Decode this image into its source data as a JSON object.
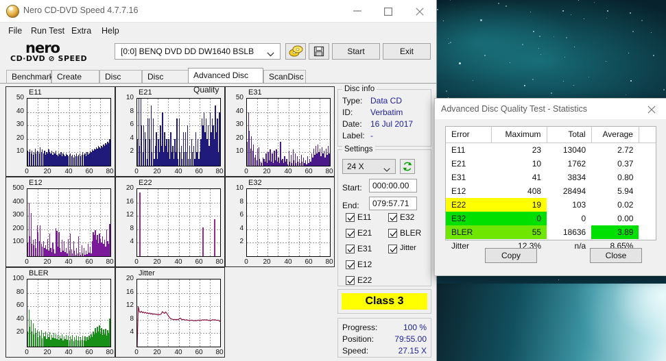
{
  "window": {
    "title": "Nero CD-DVD Speed 4.7.7.16",
    "icon": "nero-disc-icon",
    "minimize": "minimize-icon",
    "maximize": "maximize-icon",
    "close": "close-icon"
  },
  "menu": [
    "File",
    "Run Test",
    "Extra",
    "Help"
  ],
  "toolbar": {
    "logo_main": "nero",
    "logo_sub": "CD·DVD ⊘ SPEED",
    "drive": "[0:0]   BENQ DVD DD DW1640 BSLB",
    "refresh_icon": "refresh-disc-icon",
    "save_icon": "save-floppy-icon",
    "start": "Start",
    "exit": "Exit"
  },
  "tabs": [
    {
      "label": "Benchmark",
      "active": false
    },
    {
      "label": "Create Disc",
      "active": false
    },
    {
      "label": "Disc Info",
      "active": false
    },
    {
      "label": "Disc Quality",
      "active": false
    },
    {
      "label": "Advanced Disc Quality",
      "active": true
    },
    {
      "label": "ScanDisc",
      "active": false
    }
  ],
  "disc_info": {
    "legend": "Disc info",
    "rows": [
      {
        "label": "Type:",
        "value": "Data CD"
      },
      {
        "label": "ID:",
        "value": "Verbatim"
      },
      {
        "label": "Date:",
        "value": "16 Jul 2017"
      },
      {
        "label": "Label:",
        "value": "-"
      }
    ]
  },
  "settings": {
    "legend": "Settings",
    "speed": "24 X",
    "speed_refresh_icon": "refresh-arrows-icon",
    "start_label": "Start:",
    "start_value": "000:00.00",
    "end_label": "End:",
    "end_value": "079:57.71",
    "checkboxes": [
      {
        "label": "E11",
        "checked": true
      },
      {
        "label": "E21",
        "checked": true
      },
      {
        "label": "E31",
        "checked": true
      },
      {
        "label": "E12",
        "checked": true
      },
      {
        "label": "E22",
        "checked": true
      },
      {
        "label": "E32",
        "checked": true
      },
      {
        "label": "BLER",
        "checked": true
      },
      {
        "label": "Jitter",
        "checked": true
      }
    ]
  },
  "class_box": "Class 3",
  "progress": {
    "rows": [
      {
        "label": "Progress:",
        "value": "100 %"
      },
      {
        "label": "Position:",
        "value": "79:55.00"
      },
      {
        "label": "Speed:",
        "value": "27.15 X"
      }
    ]
  },
  "dialog": {
    "title": "Advanced Disc Quality Test - Statistics",
    "close_icon": "close-icon",
    "columns": [
      "Error",
      "Maximum",
      "Total",
      "Average"
    ],
    "rows": [
      {
        "error": "E11",
        "maximum": "23",
        "total": "13040",
        "average": "2.72",
        "hl": "none"
      },
      {
        "error": "E21",
        "maximum": "10",
        "total": "1762",
        "average": "0.37",
        "hl": "none"
      },
      {
        "error": "E31",
        "maximum": "41",
        "total": "3834",
        "average": "0.80",
        "hl": "none"
      },
      {
        "error": "E12",
        "maximum": "408",
        "total": "28494",
        "average": "5.94",
        "hl": "none"
      },
      {
        "error": "E22",
        "maximum": "19",
        "total": "103",
        "average": "0.02",
        "hl": "yellow"
      },
      {
        "error": "E32",
        "maximum": "0",
        "total": "0",
        "average": "0.00",
        "hl": "green"
      },
      {
        "error": "BLER",
        "maximum": "55",
        "total": "18636",
        "average": "3.89",
        "hl": "lightgreen",
        "avg_hl": "green"
      },
      {
        "error": "Jitter",
        "maximum": "12.3%",
        "total": "n/a",
        "average": "8.65%",
        "hl": "none"
      }
    ],
    "copy": "Copy",
    "close": "Close",
    "colors": {
      "yellow": "#ffff00",
      "green": "#00e000",
      "lightgreen": "#6ee600"
    }
  },
  "chart_data": [
    {
      "type": "bar",
      "title": "E11",
      "color": "#201a7a",
      "xlabel": "",
      "ylabel": "",
      "xlim": [
        0,
        80
      ],
      "ylim": [
        0,
        50
      ],
      "grid": true,
      "xticks": [
        0,
        20,
        40,
        60,
        80
      ],
      "yticks": [
        10,
        20,
        30,
        40,
        50
      ],
      "values": [
        11,
        10,
        12,
        9,
        11,
        8,
        10,
        13,
        9,
        11,
        10,
        9,
        14,
        10,
        12,
        9,
        11,
        8,
        10,
        9,
        12,
        10,
        9,
        11,
        8,
        10,
        9,
        11,
        8,
        7,
        9,
        8,
        10,
        7,
        9,
        8,
        7,
        9,
        8,
        7,
        8,
        9,
        7,
        8,
        6,
        8,
        7,
        9,
        7,
        8,
        9,
        7,
        8,
        10,
        8,
        9,
        7,
        10,
        8,
        9,
        11,
        10,
        12,
        11,
        13,
        12,
        14,
        13,
        15,
        14,
        13,
        15,
        14,
        16,
        15,
        17,
        16,
        18,
        17,
        20
      ]
    },
    {
      "type": "bar",
      "title": "E21",
      "color": "#201a7a",
      "xlabel": "",
      "ylabel": "",
      "xlim": [
        0,
        80
      ],
      "ylim": [
        0,
        10
      ],
      "grid": true,
      "xticks": [
        0,
        20,
        40,
        60,
        80
      ],
      "yticks": [
        2,
        4,
        6,
        8,
        10
      ],
      "values": [
        4,
        10,
        3,
        10,
        6,
        2,
        6,
        5,
        4,
        1,
        7,
        7,
        4,
        9,
        2,
        7,
        1,
        3,
        5,
        1,
        4,
        2,
        6,
        3,
        8,
        2,
        5,
        3,
        4,
        2,
        4,
        1,
        5,
        2,
        3,
        1,
        4,
        2,
        7,
        1,
        7,
        2,
        3,
        1,
        5,
        2,
        5,
        2,
        6,
        1,
        3,
        1,
        4,
        2,
        3,
        1,
        5,
        2,
        4,
        1,
        2,
        4,
        7,
        6,
        8,
        5,
        7,
        4,
        6,
        3,
        8,
        5,
        7,
        6,
        4,
        9,
        5,
        7,
        2,
        8
      ]
    },
    {
      "type": "bar",
      "title": "E31",
      "color": "#4a1a8a",
      "xlabel": "",
      "ylabel": "",
      "xlim": [
        0,
        80
      ],
      "ylim": [
        0,
        50
      ],
      "grid": true,
      "xticks": [
        0,
        20,
        40,
        60,
        80
      ],
      "yticks": [
        10,
        20,
        30,
        40,
        50
      ],
      "values": [
        18,
        40,
        26,
        13,
        22,
        11,
        16,
        6,
        8,
        4,
        13,
        14,
        5,
        3,
        2,
        6,
        5,
        3,
        9,
        2,
        10,
        4,
        12,
        3,
        9,
        2,
        11,
        4,
        12,
        3,
        6,
        2,
        18,
        4,
        5,
        2,
        7,
        3,
        5,
        1,
        11,
        3,
        8,
        2,
        12,
        4,
        9,
        2,
        7,
        3,
        5,
        2,
        8,
        3,
        6,
        2,
        4,
        1,
        7,
        2,
        5,
        3,
        9,
        6,
        13,
        8,
        15,
        9,
        16,
        10,
        12,
        7,
        14,
        9,
        11,
        6,
        13,
        8,
        15,
        9
      ]
    },
    {
      "type": "bar",
      "title": "E12",
      "color": "#7a1a9a",
      "xlabel": "",
      "ylabel": "",
      "xlim": [
        0,
        80
      ],
      "ylim": [
        0,
        500
      ],
      "grid": true,
      "xticks": [
        0,
        20,
        40,
        60,
        80
      ],
      "yticks": [
        100,
        200,
        300,
        400,
        500
      ],
      "values": [
        100,
        400,
        150,
        320,
        90,
        120,
        80,
        130,
        60,
        230,
        180,
        110,
        230,
        90,
        70,
        110,
        60,
        80,
        50,
        130,
        40,
        170,
        60,
        30,
        100,
        50,
        20,
        210,
        190,
        70,
        180,
        60,
        30,
        120,
        40,
        110,
        30,
        60,
        20,
        130,
        40,
        170,
        50,
        20,
        110,
        40,
        10,
        60,
        20,
        150,
        30,
        10,
        80,
        20,
        60,
        10,
        40,
        15,
        90,
        25,
        70,
        20,
        110,
        180,
        160,
        195,
        120,
        160,
        95,
        170,
        130,
        100,
        150,
        90,
        120,
        70,
        200,
        110,
        90,
        240
      ]
    },
    {
      "type": "bar",
      "title": "E22",
      "color": "#9a2a8a",
      "xlabel": "",
      "ylabel": "",
      "xlim": [
        0,
        80
      ],
      "ylim": [
        0,
        20
      ],
      "grid": true,
      "xticks": [
        0,
        20,
        40,
        60,
        80
      ],
      "yticks": [
        4,
        8,
        12,
        16,
        20
      ],
      "points": [
        {
          "x": 2,
          "y": 19
        },
        {
          "x": 63,
          "y": 8.5
        },
        {
          "x": 74,
          "y": 11
        }
      ],
      "values": []
    },
    {
      "type": "bar",
      "title": "E32",
      "color": "#7a1a9a",
      "xlabel": "",
      "ylabel": "",
      "xlim": [
        0,
        80
      ],
      "ylim": [
        0,
        10
      ],
      "grid": true,
      "xticks": [
        0,
        20,
        40,
        60,
        80
      ],
      "yticks": [
        2,
        4,
        6,
        8,
        10
      ],
      "values": []
    },
    {
      "type": "bar",
      "title": "BLER",
      "color": "#189018",
      "xlabel": "",
      "ylabel": "",
      "xlim": [
        0,
        80
      ],
      "ylim": [
        0,
        100
      ],
      "grid": true,
      "xticks": [
        0,
        20,
        40,
        60,
        80
      ],
      "yticks": [
        20,
        40,
        60,
        80,
        100
      ],
      "values": [
        22,
        55,
        30,
        40,
        22,
        35,
        18,
        28,
        20,
        25,
        14,
        22,
        16,
        24,
        12,
        20,
        15,
        22,
        11,
        18,
        14,
        21,
        10,
        17,
        13,
        20,
        12,
        18,
        11,
        17,
        10,
        16,
        12,
        18,
        9,
        15,
        11,
        17,
        10,
        16,
        9,
        15,
        11,
        17,
        8,
        14,
        10,
        16,
        9,
        15,
        8,
        14,
        10,
        16,
        9,
        15,
        8,
        14,
        10,
        16,
        12,
        18,
        14,
        22,
        18,
        28,
        20,
        30,
        22,
        32,
        19,
        28,
        17,
        26,
        18,
        27,
        16,
        24,
        20,
        42
      ]
    },
    {
      "type": "line",
      "title": "Jitter",
      "color": "#8a1040",
      "xlabel": "",
      "ylabel": "",
      "xlim": [
        0,
        80
      ],
      "ylim": [
        0,
        20
      ],
      "grid": true,
      "xticks": [
        0,
        20,
        40,
        60,
        80
      ],
      "yticks": [
        4,
        8,
        12,
        16,
        20
      ],
      "values": [
        0,
        12,
        10.4,
        10.2,
        10.5,
        10.1,
        10.3,
        10.0,
        10.2,
        9.9,
        10.1,
        9.8,
        10.0,
        9.7,
        9.9,
        9.6,
        9.8,
        9.6,
        9.7,
        9.5,
        9.6,
        9.5,
        9.6,
        9.8,
        10.4,
        10.1,
        9.9,
        10.3,
        10.0,
        9.5,
        9.0,
        8.6,
        8.3,
        8.2,
        8.1,
        8.0,
        8.1,
        8.0,
        8.1,
        8.0,
        8.3,
        8.5,
        8.2,
        8.0,
        8.1,
        8.0,
        7.9,
        8.0,
        7.9,
        7.8,
        7.9,
        7.8,
        7.9,
        7.8,
        7.7,
        7.8,
        7.7,
        7.8,
        7.9,
        7.8,
        7.9,
        7.8,
        8.0,
        7.9,
        8.0,
        7.9,
        8.0,
        7.9,
        7.8,
        7.9,
        7.8,
        7.9,
        8.0,
        7.9,
        8.0,
        7.9,
        7.8,
        7.9,
        7.7,
        7.4
      ]
    }
  ]
}
